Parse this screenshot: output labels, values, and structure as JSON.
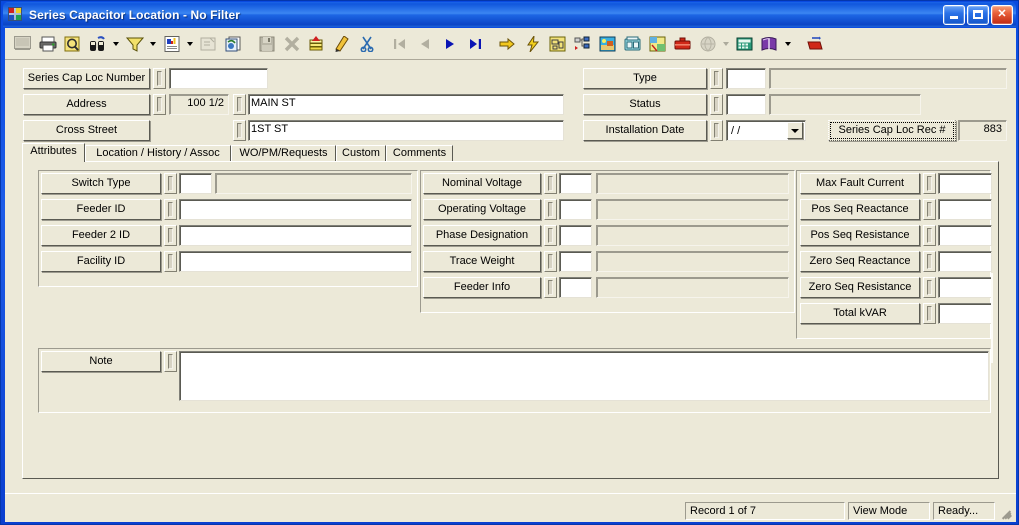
{
  "window": {
    "title": "Series Capacitor Location - No Filter",
    "icon": "app-cube-icon",
    "minimize_label": "Minimize",
    "maximize_label": "Maximize",
    "close_label": "Close",
    "accent_titlebar": "#1d66e4",
    "face_color": "#ece9d8"
  },
  "toolbar": {
    "buttons": [
      {
        "name": "screen-icon",
        "disabled": true
      },
      {
        "name": "print-icon",
        "disabled": false
      },
      {
        "name": "print-preview-icon",
        "disabled": false
      },
      {
        "name": "find-binoculars-icon",
        "disabled": false
      },
      {
        "name": "dropdown-arrow",
        "kind": "drop"
      },
      {
        "name": "filter-funnel-icon",
        "disabled": false
      },
      {
        "name": "dropdown-arrow",
        "kind": "drop"
      },
      {
        "name": "report-icon",
        "disabled": false
      },
      {
        "name": "dropdown-arrow",
        "kind": "drop"
      },
      {
        "name": "properties-icon",
        "disabled": true
      },
      {
        "name": "copy-record-icon",
        "disabled": false
      },
      {
        "name": "separator",
        "kind": "sep"
      },
      {
        "name": "save-icon",
        "disabled": true
      },
      {
        "name": "delete-x-icon",
        "disabled": true
      },
      {
        "name": "stack-layers-icon",
        "disabled": false
      },
      {
        "name": "edit-pencil-icon",
        "disabled": false
      },
      {
        "name": "cut-scissors-icon",
        "disabled": false
      },
      {
        "name": "separator",
        "kind": "sep"
      },
      {
        "name": "first-record-icon",
        "disabled": true
      },
      {
        "name": "previous-record-icon",
        "disabled": true
      },
      {
        "name": "next-record-icon",
        "disabled": false
      },
      {
        "name": "last-record-icon",
        "disabled": false
      },
      {
        "name": "separator",
        "kind": "sep"
      },
      {
        "name": "goto-arrow-icon",
        "disabled": false
      },
      {
        "name": "lightning-icon",
        "disabled": false
      },
      {
        "name": "map-view-icon",
        "disabled": false
      },
      {
        "name": "tree-hierarchy-icon",
        "disabled": false
      },
      {
        "name": "gis-picture-icon",
        "disabled": false
      },
      {
        "name": "fax-machine-icon",
        "disabled": false
      },
      {
        "name": "map-region-icon",
        "disabled": false
      },
      {
        "name": "toolbox-icon",
        "disabled": false
      },
      {
        "name": "sphere-icon",
        "disabled": true
      },
      {
        "name": "dropdown-arrow",
        "kind": "drop",
        "disabled": true
      },
      {
        "name": "calculator-icon",
        "disabled": false
      },
      {
        "name": "book-icon",
        "disabled": false
      },
      {
        "name": "dropdown-arrow",
        "kind": "drop"
      },
      {
        "name": "separator",
        "kind": "sep"
      },
      {
        "name": "export-icon",
        "disabled": false
      }
    ]
  },
  "header": {
    "left_fields": [
      {
        "label": "Series Cap Loc Number",
        "value": "",
        "has_spin": true
      },
      {
        "label": "Address",
        "value_num": "100 1/2",
        "value": "MAIN ST",
        "has_spin": true,
        "has_second_spin": true
      },
      {
        "label": "Cross Street",
        "value": "1ST ST",
        "has_spin": true
      }
    ],
    "right_fields": [
      {
        "label": "Type",
        "code": "",
        "desc": ""
      },
      {
        "label": "Status",
        "code": "",
        "desc": ""
      },
      {
        "label": "Installation Date",
        "date": "/  /"
      }
    ],
    "rec_button_label": "Series Cap Loc Rec #",
    "rec_value": "883"
  },
  "tabs": [
    {
      "label": "Attributes",
      "selected": true
    },
    {
      "label": "Location / History / Assoc",
      "selected": false
    },
    {
      "label": "WO/PM/Requests",
      "selected": false
    },
    {
      "label": "Custom",
      "selected": false
    },
    {
      "label": "Comments",
      "selected": false
    }
  ],
  "attributes": {
    "column1": [
      {
        "label": "Switch Type",
        "code": "",
        "desc": "",
        "style": "code-desc"
      },
      {
        "label": "Feeder ID",
        "value": "",
        "style": "wide"
      },
      {
        "label": "Feeder 2 ID",
        "value": "",
        "style": "wide"
      },
      {
        "label": "Facility ID",
        "value": "",
        "style": "wide"
      }
    ],
    "column2": [
      {
        "label": "Nominal Voltage",
        "code": "",
        "desc": ""
      },
      {
        "label": "Operating Voltage",
        "code": "",
        "desc": ""
      },
      {
        "label": "Phase Designation",
        "code": "",
        "desc": ""
      },
      {
        "label": "Trace Weight",
        "code": "",
        "desc": ""
      },
      {
        "label": "Feeder Info",
        "code": "",
        "desc": ""
      }
    ],
    "column3": [
      {
        "label": "Max Fault Current",
        "value": ""
      },
      {
        "label": "Pos Seq Reactance",
        "value": ""
      },
      {
        "label": "Pos Seq Resistance",
        "value": ""
      },
      {
        "label": "Zero Seq Reactance",
        "value": ""
      },
      {
        "label": "Zero Seq Resistance",
        "value": ""
      },
      {
        "label": "Total kVAR",
        "value": ""
      }
    ],
    "note": {
      "label": "Note",
      "value": ""
    }
  },
  "statusbar": {
    "record": "Record 1 of 7",
    "mode": "View Mode",
    "state": "Ready..."
  }
}
